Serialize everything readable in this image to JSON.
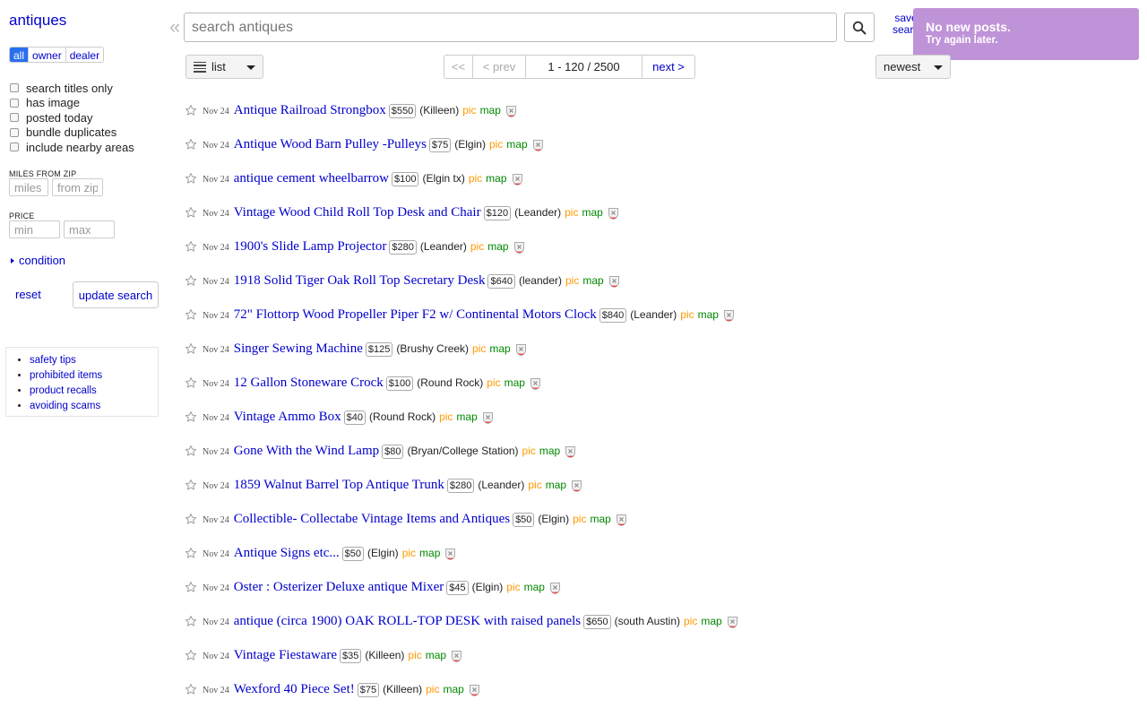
{
  "sidebar": {
    "category": "antiques",
    "seller_filters": [
      {
        "label": "all",
        "active": true
      },
      {
        "label": "owner",
        "active": false
      },
      {
        "label": "dealer",
        "active": false
      }
    ],
    "checkboxes": [
      {
        "label": "search titles only",
        "checked": false
      },
      {
        "label": "has image",
        "checked": false
      },
      {
        "label": "posted today",
        "checked": false
      },
      {
        "label": "bundle duplicates",
        "checked": false
      },
      {
        "label": "include nearby areas",
        "checked": false
      }
    ],
    "miles_label": "MILES FROM ZIP",
    "miles_placeholder": "miles",
    "zip_placeholder": "from zip",
    "price_label": "PRICE",
    "min_placeholder": "min",
    "max_placeholder": "max",
    "condition_label": "condition",
    "reset_label": "reset",
    "update_label": "update search",
    "tips": [
      "safety tips",
      "prohibited items",
      "product recalls",
      "avoiding scams"
    ]
  },
  "topbar": {
    "collapse_glyph": "«",
    "search_placeholder": "search antiques",
    "save_search_line1": "save",
    "save_search_line2": "search"
  },
  "toast": {
    "title": "No new posts.",
    "subtitle": "Try again later."
  },
  "controls": {
    "view_label": "list",
    "pager_first": "<<",
    "pager_prev": "< prev",
    "pager_range": "1 - 120 / 2500",
    "pager_next": "next >",
    "sort_label": "newest"
  },
  "colors": {
    "link": "#0000cc",
    "pic": "#ff9900",
    "map": "#008800",
    "toast_bg": "#bf93d8",
    "active_filter": "#2a6ef0"
  },
  "listings": [
    {
      "date": "Nov 24",
      "title": "Antique Railroad Strongbox",
      "price": "$550",
      "location": "(Killeen)",
      "pic": "pic",
      "map": "map"
    },
    {
      "date": "Nov 24",
      "title": "Antique Wood Barn Pulley -Pulleys",
      "price": "$75",
      "location": "(Elgin)",
      "pic": "pic",
      "map": "map"
    },
    {
      "date": "Nov 24",
      "title": "antique cement wheelbarrow",
      "price": "$100",
      "location": "(Elgin tx)",
      "pic": "pic",
      "map": "map"
    },
    {
      "date": "Nov 24",
      "title": "Vintage Wood Child Roll Top Desk and Chair",
      "price": "$120",
      "location": "(Leander)",
      "pic": "pic",
      "map": "map"
    },
    {
      "date": "Nov 24",
      "title": "1900's Slide Lamp Projector",
      "price": "$280",
      "location": "(Leander)",
      "pic": "pic",
      "map": "map"
    },
    {
      "date": "Nov 24",
      "title": "1918 Solid Tiger Oak Roll Top Secretary Desk",
      "price": "$640",
      "location": "(leander)",
      "pic": "pic",
      "map": "map"
    },
    {
      "date": "Nov 24",
      "title": "72\" Flottorp Wood Propeller Piper F2 w/ Continental Motors Clock",
      "price": "$840",
      "location": "(Leander)",
      "pic": "pic",
      "map": "map"
    },
    {
      "date": "Nov 24",
      "title": "Singer Sewing Machine",
      "price": "$125",
      "location": "(Brushy Creek)",
      "pic": "pic",
      "map": "map"
    },
    {
      "date": "Nov 24",
      "title": "12 Gallon Stoneware Crock",
      "price": "$100",
      "location": "(Round Rock)",
      "pic": "pic",
      "map": "map"
    },
    {
      "date": "Nov 24",
      "title": "Vintage Ammo Box",
      "price": "$40",
      "location": "(Round Rock)",
      "pic": "pic",
      "map": "map"
    },
    {
      "date": "Nov 24",
      "title": "Gone With the Wind Lamp",
      "price": "$80",
      "location": "(Bryan/College Station)",
      "pic": "pic",
      "map": "map"
    },
    {
      "date": "Nov 24",
      "title": "1859 Walnut Barrel Top Antique Trunk",
      "price": "$280",
      "location": "(Leander)",
      "pic": "pic",
      "map": "map"
    },
    {
      "date": "Nov 24",
      "title": "Collectible- Collectabe Vintage Items and Antiques",
      "price": "$50",
      "location": "(Elgin)",
      "pic": "pic",
      "map": "map"
    },
    {
      "date": "Nov 24",
      "title": "Antique Signs etc...",
      "price": "$50",
      "location": "(Elgin)",
      "pic": "pic",
      "map": "map"
    },
    {
      "date": "Nov 24",
      "title": "Oster : Osterizer Deluxe antique Mixer",
      "price": "$45",
      "location": "(Elgin)",
      "pic": "pic",
      "map": "map"
    },
    {
      "date": "Nov 24",
      "title": "antique (circa 1900) OAK ROLL-TOP DESK with raised panels",
      "price": "$650",
      "location": "(south Austin)",
      "pic": "pic",
      "map": "map"
    },
    {
      "date": "Nov 24",
      "title": "Vintage Fiestaware",
      "price": "$35",
      "location": "(Killeen)",
      "pic": "pic",
      "map": "map"
    },
    {
      "date": "Nov 24",
      "title": "Wexford 40 Piece Set!",
      "price": "$75",
      "location": "(Killeen)",
      "pic": "pic",
      "map": "map"
    }
  ]
}
